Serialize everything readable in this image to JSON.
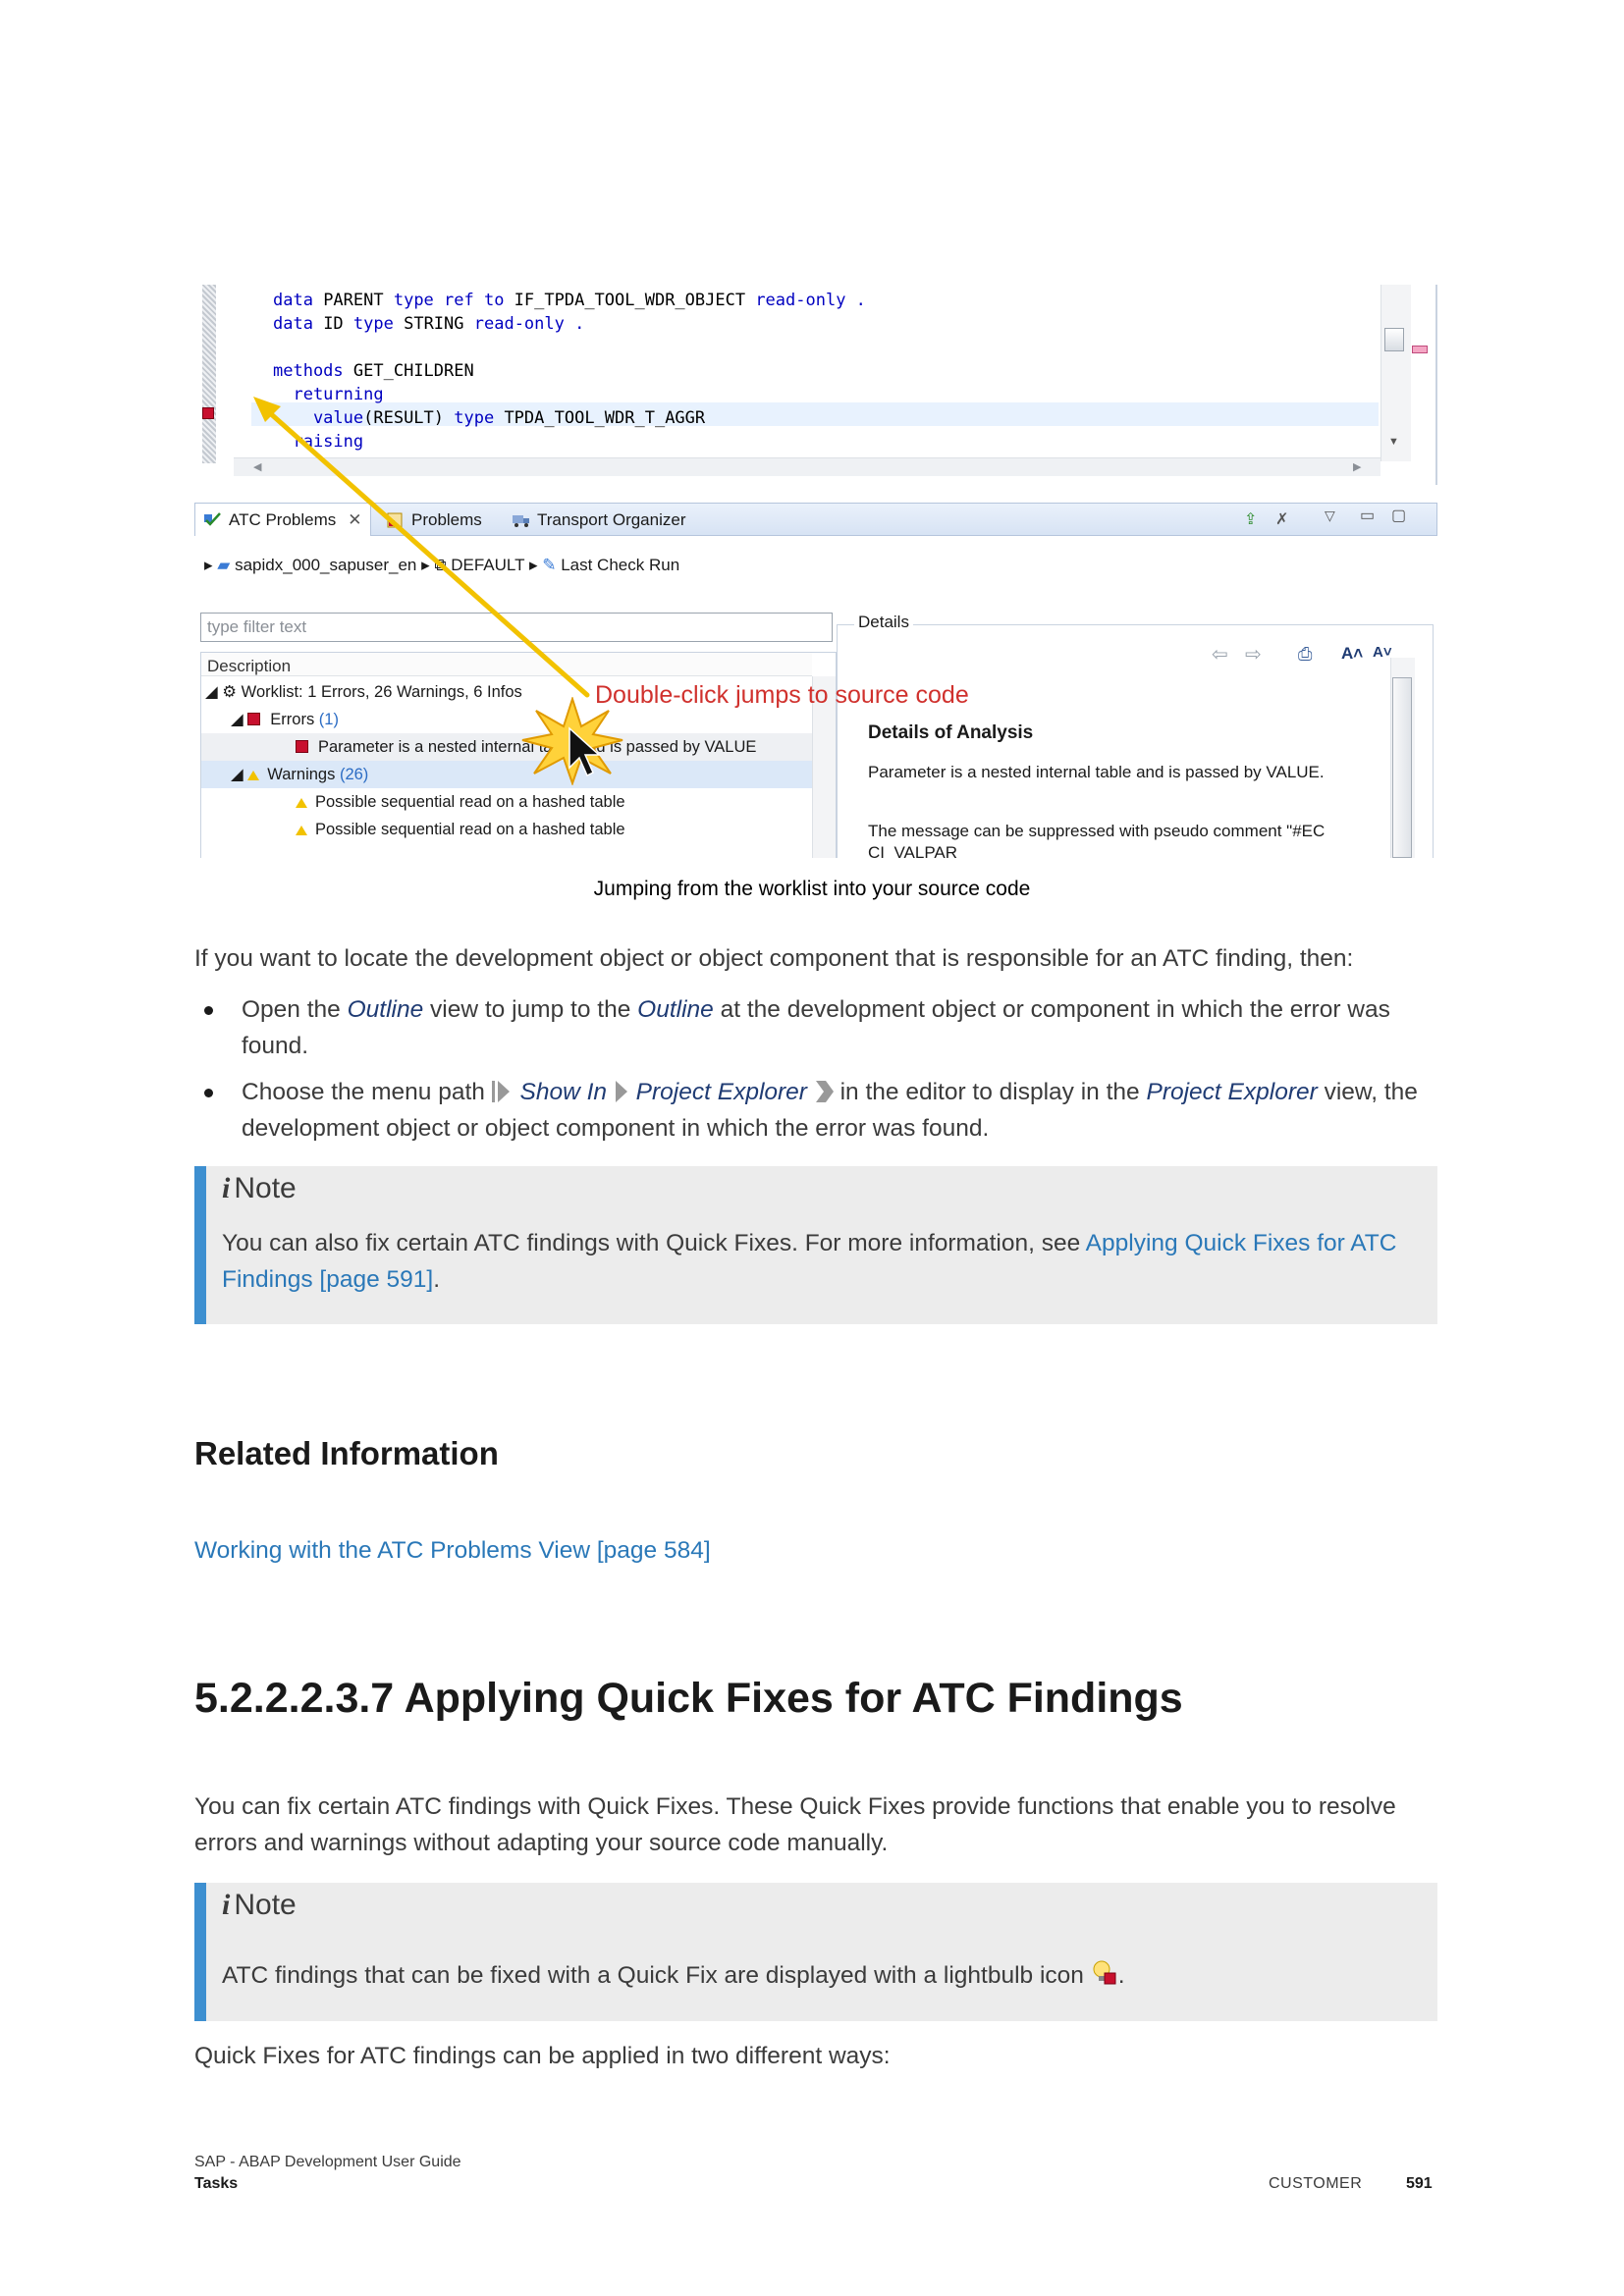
{
  "screenshot": {
    "code_lines": [
      {
        "keyword": "data ",
        "text": "PARENT ",
        "kw2": "type ref to ",
        "text2": "IF_TPDA_TOOL_WDR_OBJECT ",
        "kw3": "read-only ."
      },
      {
        "keyword": "data ",
        "text": "ID ",
        "kw2": "type ",
        "text2": "STRING ",
        "kw3": "read-only ."
      },
      {
        "keyword": "",
        "text": "",
        "kw2": "",
        "text2": "",
        "kw3": ""
      },
      {
        "keyword": "methods ",
        "text": "GET_CHILDREN",
        "kw2": "",
        "text2": "",
        "kw3": ""
      },
      {
        "keyword": "  returning",
        "text": "",
        "kw2": "",
        "text2": "",
        "kw3": ""
      },
      {
        "keyword": "    value",
        "text": "(RESULT) ",
        "kw2": "type ",
        "text2": "TPDA_TOOL_WDR_T_AGGR",
        "kw3": ""
      },
      {
        "keyword": "  raising",
        "text": "",
        "kw2": "",
        "text2": "",
        "kw3": ""
      }
    ],
    "tabs": [
      "ATC Problems",
      "Problems",
      "Transport Organizer"
    ],
    "breadcrumbs": [
      "sapidx_000_sapuser_en",
      "DEFAULT",
      "Last Check Run"
    ],
    "filter_placeholder": "type filter text",
    "tree_header": "Description",
    "tree_rows": {
      "worklist": "Worklist: 1 Errors, 26 Warnings, 6 Infos",
      "errors": "Errors",
      "errors_count": "(1)",
      "error_item": "Parameter is a nested internal table and is passed by VALUE",
      "warnings": "Warnings",
      "warnings_count": "(26)",
      "warning_item_1": "Possible sequential read on a hashed table",
      "warning_item_2": "Possible sequential read on a hashed table"
    },
    "details_label": "Details",
    "details_title": "Details of Analysis",
    "details_text_1": "Parameter is a nested internal table and is passed by VALUE.",
    "details_text_2": "The message can be suppressed with pseudo comment \"#EC CI_VALPAR",
    "callout": "Double-click jumps to source code",
    "colors": {
      "callout": "#d0312d",
      "arrow": "#f2c200",
      "tab_bg": "#d7e3f4"
    }
  },
  "caption": "Jumping from the worklist into your source code",
  "intro": "If you want to locate the development object or object component that is responsible for an ATC finding, then:",
  "bullet1": {
    "a": "Open the ",
    "outline1": "Outline",
    "b": " view to jump to the ",
    "outline2": "Outline",
    "c": " at the development object or component in which the error was found."
  },
  "bullet2": {
    "a": "Choose the menu path ",
    "show_in": "Show In",
    "project_explorer": "Project Explorer",
    "b": " in the editor to display in the ",
    "pe_view": "Project Explorer",
    "c": " view, the development object or object component in which the error was found."
  },
  "note1": {
    "title": "Note",
    "text": "You can also fix certain ATC findings with Quick Fixes. For more information, see ",
    "link": "Applying Quick Fixes for ATC Findings [page 591]",
    "end": "."
  },
  "related_title": "Related Information",
  "related_link": "Working with the ATC Problems View [page 584]",
  "section_title": "5.2.2.2.3.7  Applying Quick Fixes for ATC Findings",
  "section_para": "You can fix certain ATC findings with Quick Fixes. These Quick Fixes provide functions that enable you to resolve errors and warnings without adapting your source code manually.",
  "note2": {
    "title": "Note",
    "text": "ATC findings that can be fixed with a Quick Fix are displayed with a lightbulb icon ",
    "end": "."
  },
  "closing": "Quick Fixes for ATC findings can be applied in two different ways:",
  "footer": {
    "doc": "SAP - ABAP Development User Guide",
    "section": "Tasks",
    "classification": "CUSTOMER",
    "page": "591"
  },
  "colors": {
    "link": "#2a78b8",
    "note_bar": "#3d8fd0",
    "note_bg": "#ececec"
  }
}
